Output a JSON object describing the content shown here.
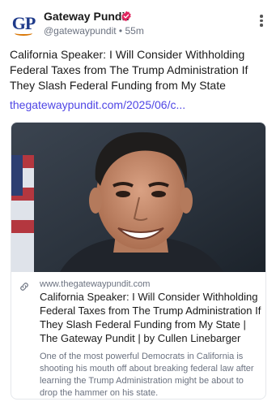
{
  "author": {
    "name": "Gateway Pundit",
    "handle": "@gatewaypundit",
    "time": "55m",
    "avatar_text": "GP",
    "verified_color": "#e0245e"
  },
  "post": {
    "text": "California Speaker: I Will Consider Withholding Federal Taxes from The Trump Administration If They Slash Federal Funding from My State",
    "link": "thegatewaypundit.com/2025/06/c..."
  },
  "card": {
    "domain": "www.thegatewaypundit.com",
    "title": "California Speaker: I Will Consider Withholding Federal Taxes from The Trump Administration If They Slash Federal Funding from My State | The Gateway Pundit | by Cullen Linebarger",
    "description": "One of the most powerful Democrats in California is shooting his mouth off about breaking federal law after learning the Trump Administration might be about to drop the hammer on his state."
  },
  "colors": {
    "link": "#4f46e5",
    "meta": "#6b7280",
    "brand_blue": "#1e3a8a",
    "brand_orange": "#d97706"
  },
  "icons": [
    "verified-badge-icon",
    "more-options-icon",
    "link-icon"
  ]
}
